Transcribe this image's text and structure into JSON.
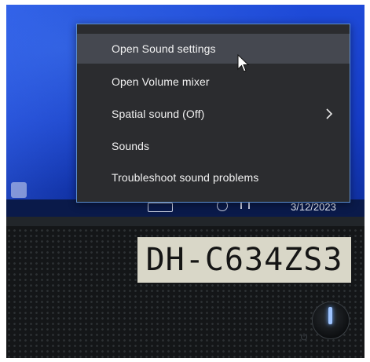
{
  "context_menu": {
    "items": [
      {
        "label": "Open Sound settings"
      },
      {
        "label": "Open Volume mixer"
      },
      {
        "label": "Spatial sound (Off)"
      },
      {
        "label": "Sounds"
      },
      {
        "label": "Troubleshoot sound problems"
      }
    ],
    "hovered_item": "Open Sound settings",
    "colors": {
      "menu_bg": "#2b2c2f",
      "hover_bg": "#454850",
      "border": "#5d8fd0",
      "text": "#f2f2f2"
    }
  },
  "taskbar": {
    "date": "3/12/2023"
  },
  "monitor": {
    "asset_label": "DH-C634ZS3",
    "screen_color": "#1e4ad8"
  },
  "icons": [
    "chevron-right-icon",
    "mouse-pointer-icon",
    "power-icon",
    "speaker-icon",
    "network-icon"
  ]
}
